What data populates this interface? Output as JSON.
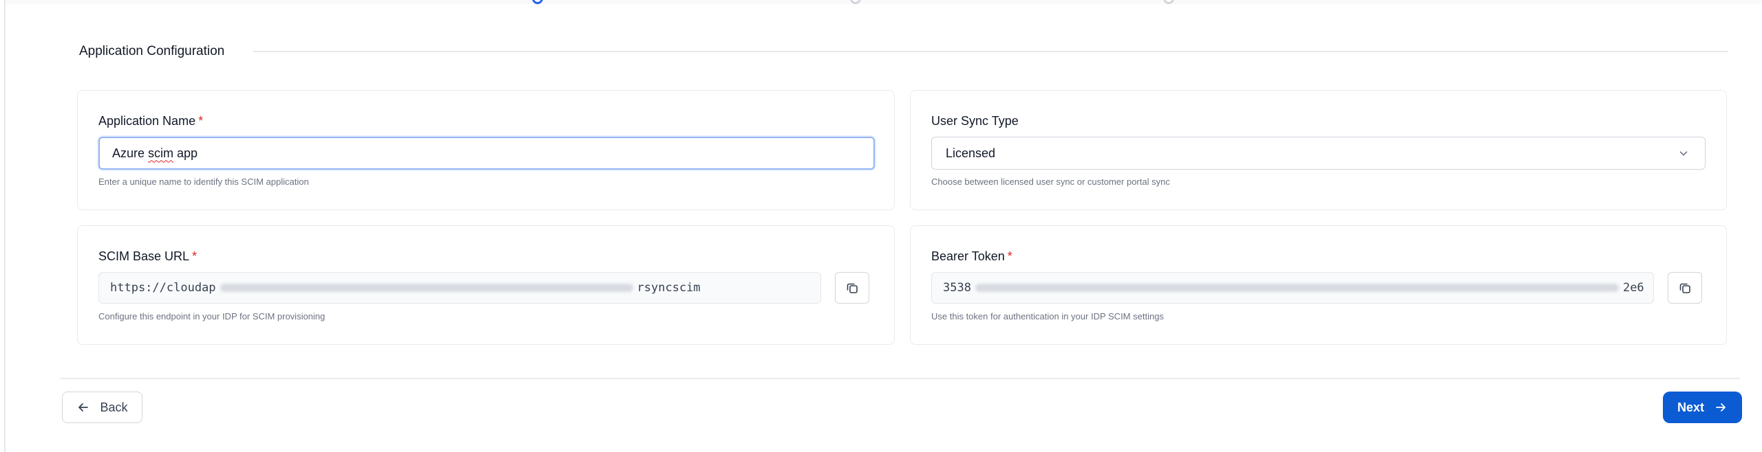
{
  "section": {
    "title": "Application Configuration"
  },
  "application_name": {
    "label": "Application Name",
    "required_mark": "*",
    "value_prefix": "Azure ",
    "value_misspelled": "scim",
    "value_suffix": " app",
    "helper": "Enter a unique name to identify this SCIM application"
  },
  "user_sync_type": {
    "label": "User Sync Type",
    "selected": "Licensed",
    "helper": "Choose between licensed user sync or customer portal sync",
    "icon": "chevron-down-icon"
  },
  "scim_base_url": {
    "label": "SCIM Base URL",
    "required_mark": "*",
    "value_visible_start": "https://cloudap",
    "value_visible_end": "rsyncscim",
    "helper": "Configure this endpoint in your IDP for SCIM provisioning",
    "copy_icon": "copy-icon"
  },
  "bearer_token": {
    "label": "Bearer Token",
    "required_mark": "*",
    "value_visible_start": "3538",
    "value_visible_end": "2e6",
    "helper": "Use this token for authentication in your IDP SCIM settings",
    "copy_icon": "copy-icon"
  },
  "footer": {
    "back_label": "Back",
    "next_label": "Next",
    "back_icon": "arrow-left-icon",
    "next_icon": "arrow-right-icon"
  },
  "colors": {
    "primary": "#0b5bd3",
    "required": "#dc2626",
    "focus_border": "#93b4f3",
    "helper_text": "#6b7280"
  }
}
